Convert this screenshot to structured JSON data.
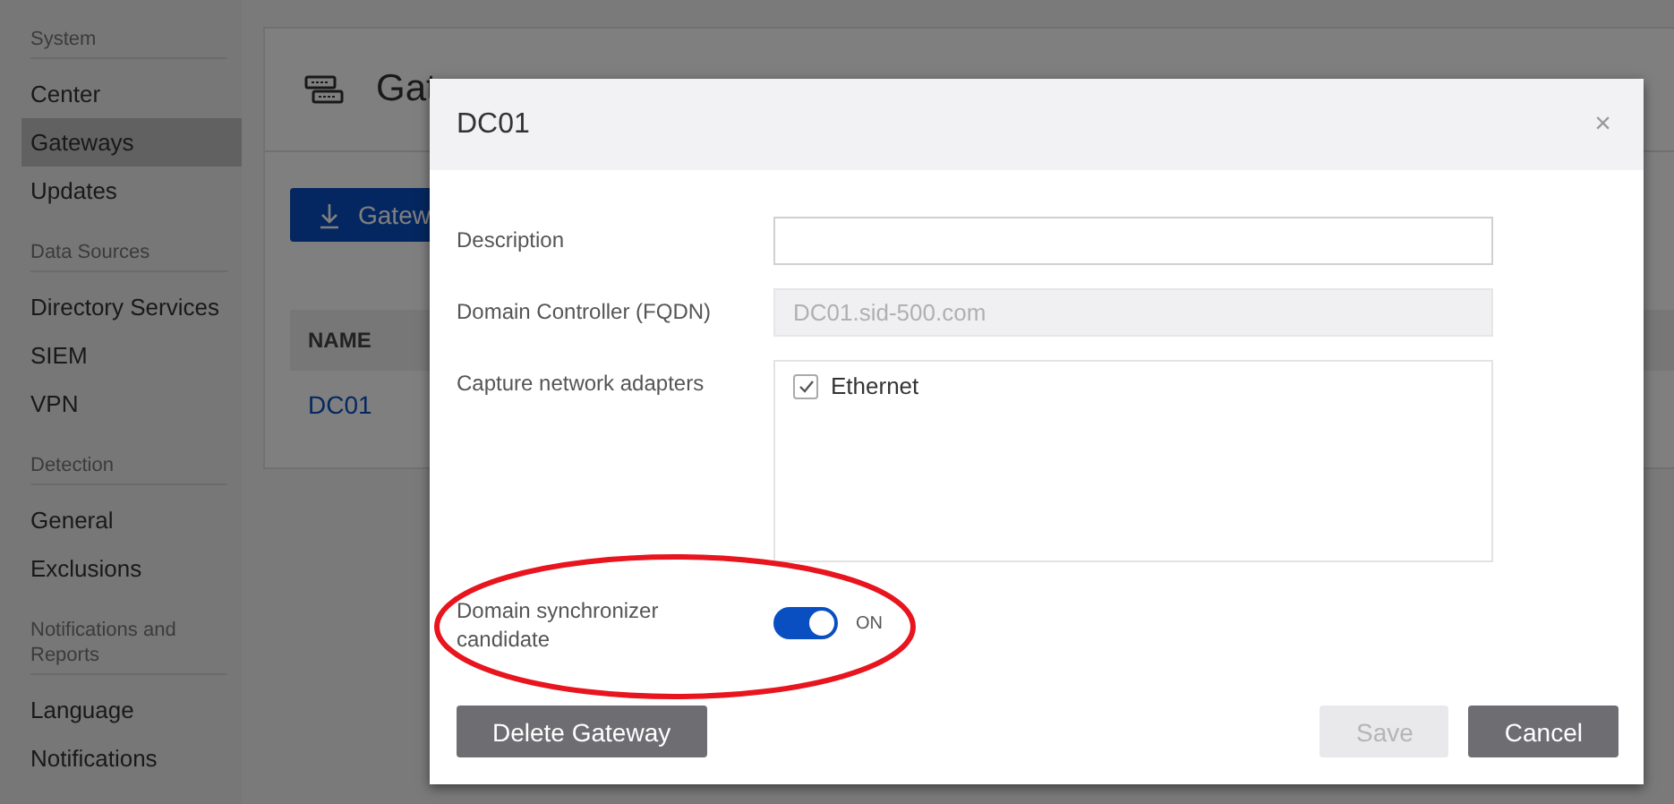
{
  "sidebar": {
    "sections": [
      {
        "heading": "System",
        "items": [
          {
            "label": "Center",
            "selected": false
          },
          {
            "label": "Gateways",
            "selected": true
          },
          {
            "label": "Updates",
            "selected": false
          }
        ]
      },
      {
        "heading": "Data Sources",
        "items": [
          {
            "label": "Directory Services",
            "selected": false
          },
          {
            "label": "SIEM",
            "selected": false
          },
          {
            "label": "VPN",
            "selected": false
          }
        ]
      },
      {
        "heading": "Detection",
        "items": [
          {
            "label": "General",
            "selected": false
          },
          {
            "label": "Exclusions",
            "selected": false
          }
        ]
      },
      {
        "heading": "Notifications and Reports",
        "items": [
          {
            "label": "Language",
            "selected": false
          },
          {
            "label": "Notifications",
            "selected": false
          }
        ]
      }
    ]
  },
  "page": {
    "title": "Gat",
    "primary_button": "Gatew",
    "table": {
      "columns": [
        "NAME"
      ],
      "rows": [
        [
          "DC01"
        ]
      ]
    }
  },
  "dialog": {
    "title": "DC01",
    "close": "×",
    "fields": [
      {
        "kind": "text",
        "label": "Description",
        "disabled": false
      },
      {
        "kind": "text",
        "label": "Domain Controller (FQDN)",
        "value": "DC01.sid-500.com",
        "disabled": true
      },
      {
        "kind": "checklist",
        "label": "Capture network adapters",
        "options": [
          {
            "label": "Ethernet",
            "checked": true
          }
        ]
      },
      {
        "kind": "toggle",
        "label": "Domain synchronizer candidate",
        "on": true,
        "state_text": "ON"
      }
    ],
    "buttons": [
      {
        "label": "Delete Gateway",
        "disabled": false
      },
      {
        "label": "Save",
        "disabled": true
      },
      {
        "label": "Cancel",
        "disabled": false
      }
    ],
    "annotation": {
      "kind": "ellipse"
    }
  }
}
